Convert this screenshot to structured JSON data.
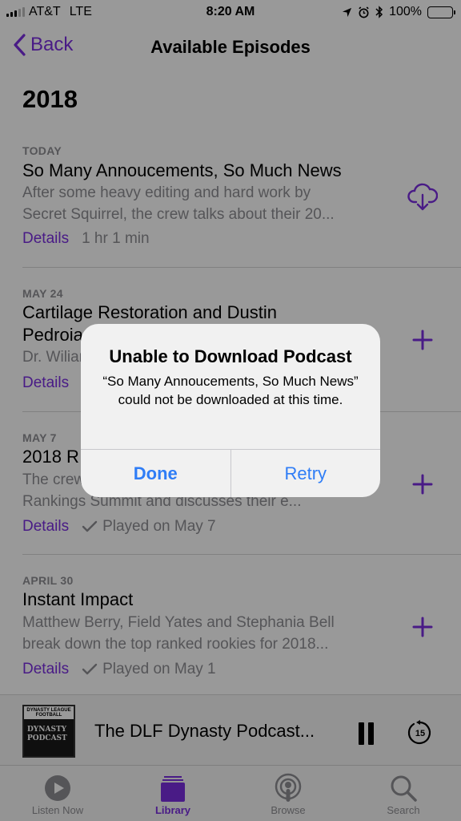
{
  "status": {
    "carrier": "AT&T",
    "network": "LTE",
    "time": "8:20 AM",
    "battery": "100%"
  },
  "nav": {
    "back_label": "Back",
    "title": "Available Episodes"
  },
  "year": "2018",
  "episodes": [
    {
      "date": "TODAY",
      "title": "So Many Annoucements, So Much News",
      "desc1": "After some heavy editing and hard work by",
      "desc2": "Secret Squirrel, the crew talks about their 20...",
      "details": "Details",
      "meta": "1 hr 1 min",
      "action": "download-cloud-icon"
    },
    {
      "date": "MAY 24",
      "title": "Cartilage Restoration and Dustin",
      "title2": "Pedroia",
      "desc1": "Dr. Wiliam",
      "desc2": "",
      "details": "Details",
      "meta": "",
      "action": "plus-icon"
    },
    {
      "date": "MAY 7",
      "title": "2018 R",
      "desc1": "The crew",
      "desc2": "Rankings Summit and discusses their e...",
      "details": "Details",
      "meta": "Played on May 7",
      "action": "plus-icon"
    },
    {
      "date": "APRIL 30",
      "title": "Instant Impact",
      "desc1": "Matthew Berry, Field Yates and Stephania Bell",
      "desc2": "break down the top ranked rookies for 2018...",
      "details": "Details",
      "meta": "Played on May 1",
      "action": "plus-icon"
    }
  ],
  "player": {
    "art_top": "DYNASTY LEAGUE FOOTBALL",
    "art_line1": "DYNASTY",
    "art_line2": "PODCAST",
    "title": "The DLF Dynasty Podcast...",
    "skip_seconds": "15"
  },
  "tabs": [
    {
      "label": "Listen Now",
      "icon": "play-circle-icon"
    },
    {
      "label": "Library",
      "icon": "library-icon",
      "active": true
    },
    {
      "label": "Browse",
      "icon": "podcast-icon"
    },
    {
      "label": "Search",
      "icon": "search-icon"
    }
  ],
  "alert": {
    "title": "Unable to Download Podcast",
    "message": "“So Many Annoucements, So Much News” could not be downloaded at this time.",
    "done": "Done",
    "retry": "Retry"
  },
  "colors": {
    "accent": "#7a2ee0",
    "alert_button": "#2f7df6",
    "secondary_text": "#8e8e93"
  }
}
